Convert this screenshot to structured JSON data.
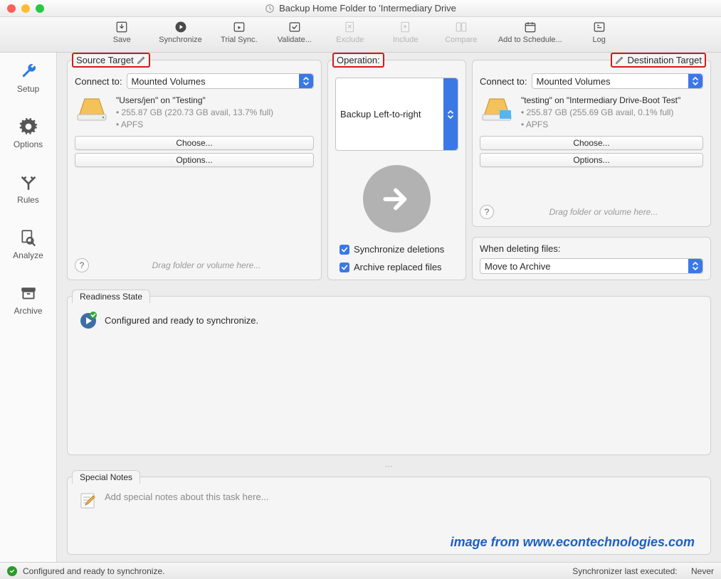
{
  "window": {
    "title": "Backup Home Folder to 'Intermediary Drive"
  },
  "toolbar": {
    "save": "Save",
    "sync": "Synchronize",
    "trial": "Trial Sync.",
    "validate": "Validate...",
    "exclude": "Exclude",
    "include": "Include",
    "compare": "Compare",
    "schedule": "Add to Schedule...",
    "log": "Log"
  },
  "sidebar": {
    "setup": "Setup",
    "options": "Options",
    "rules": "Rules",
    "analyze": "Analyze",
    "archive": "Archive"
  },
  "source": {
    "header": "Source Target",
    "connect_label": "Connect to:",
    "connect_value": "Mounted Volumes",
    "vol_title": "\"Users/jen\" on \"Testing\"",
    "vol_line1": "• 255.87 GB (220.73 GB avail, 13.7% full)",
    "vol_line2": "• APFS",
    "choose": "Choose...",
    "options": "Options...",
    "drop_hint": "Drag folder or volume here..."
  },
  "operation": {
    "header": "Operation:",
    "mode": "Backup Left-to-right",
    "sync_del": "Synchronize deletions",
    "archive_rep": "Archive replaced files"
  },
  "destination": {
    "header": "Destination Target",
    "connect_label": "Connect to:",
    "connect_value": "Mounted Volumes",
    "vol_title": "\"testing\" on \"Intermediary Drive-Boot Test\"",
    "vol_line1": "• 255.87 GB (255.69 GB avail, 0.1% full)",
    "vol_line2": "• APFS",
    "choose": "Choose...",
    "options": "Options...",
    "drop_hint": "Drag folder or volume here...",
    "delete_label": "When deleting files:",
    "delete_mode": "Move to Archive"
  },
  "readiness": {
    "tab": "Readiness State",
    "text": "Configured and ready to synchronize."
  },
  "notes": {
    "tab": "Special Notes",
    "placeholder": "Add special notes about this task here..."
  },
  "watermark": "image from www.econtechnologies.com",
  "status": {
    "left": "Configured and ready to synchronize.",
    "right_label": "Synchronizer last executed:",
    "right_value": "Never"
  }
}
